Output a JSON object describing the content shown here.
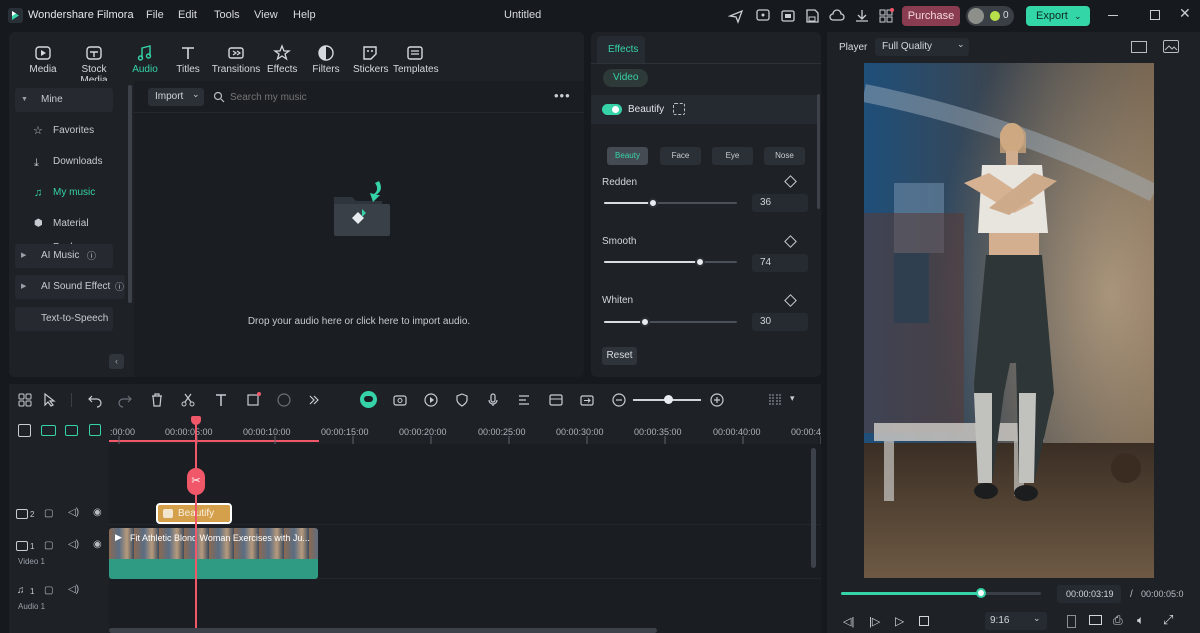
{
  "app": {
    "name": "Wondershare Filmora",
    "title": "Untitled",
    "menu": [
      "File",
      "Edit",
      "Tools",
      "View",
      "Help"
    ],
    "purchase_label": "Purchase",
    "credits": "0",
    "export_label": "Export"
  },
  "media": {
    "tabs": [
      {
        "label": "Media",
        "icon": "media-icon"
      },
      {
        "label": "Stock Media",
        "icon": "stock-media-icon"
      },
      {
        "label": "Audio",
        "icon": "audio-icon"
      },
      {
        "label": "Titles",
        "icon": "titles-icon"
      },
      {
        "label": "Transitions",
        "icon": "transitions-icon"
      },
      {
        "label": "Effects",
        "icon": "effects-icon"
      },
      {
        "label": "Filters",
        "icon": "filters-icon"
      },
      {
        "label": "Stickers",
        "icon": "stickers-icon"
      },
      {
        "label": "Templates",
        "icon": "templates-icon"
      }
    ],
    "active_tab": "Audio",
    "sidebar": {
      "mine": "Mine",
      "items": [
        "Favorites",
        "Downloads",
        "My music",
        "Material Pack"
      ],
      "ai_music": "AI Music",
      "ai_sound_effect": "AI Sound Effect",
      "tts": "Text-to-Speech"
    },
    "import_label": "Import",
    "search_placeholder": "Search my music",
    "drop_text": "Drop your audio here or click here to import audio."
  },
  "effects": {
    "tab": "Effects",
    "video_label": "Video",
    "beautify_label": "Beautify",
    "beautify_on": true,
    "subtabs": [
      "Beauty",
      "Face",
      "Eye",
      "Nose"
    ],
    "active_subtab": "Beauty",
    "sliders": [
      {
        "label": "Redden",
        "value": "36"
      },
      {
        "label": "Smooth",
        "value": "74"
      },
      {
        "label": "Whiten",
        "value": "30"
      }
    ],
    "reset_label": "Reset"
  },
  "player": {
    "label": "Player",
    "quality": "Full Quality",
    "current_time": "00:00:03:19",
    "separator": "/",
    "total_time": "00:00:05:0",
    "progress": 0.7,
    "aspect": "9:16"
  },
  "timeline": {
    "ticks": [
      ":00:00",
      "00:00:05:00",
      "00:00:10:00",
      "00:00:15:00",
      "00:00:20:00",
      "00:00:25:00",
      "00:00:30:00",
      "00:00:35:00",
      "00:00:40:00",
      "00:00:4"
    ],
    "tracks": [
      {
        "num": "2",
        "name": ""
      },
      {
        "num": "1",
        "name": "Video 1"
      },
      {
        "num": "1",
        "name": "Audio 1"
      }
    ],
    "effect_clip": "Beautify",
    "video_clip": "Fit Athletic Blond Woman Exercises with Ju..."
  },
  "colors": {
    "accent": "#36d3a8",
    "purchase": "#8a3d50",
    "playhead": "#f0586a",
    "clip_effect": "#d4a04b",
    "clip_audio": "#2f9b82"
  }
}
